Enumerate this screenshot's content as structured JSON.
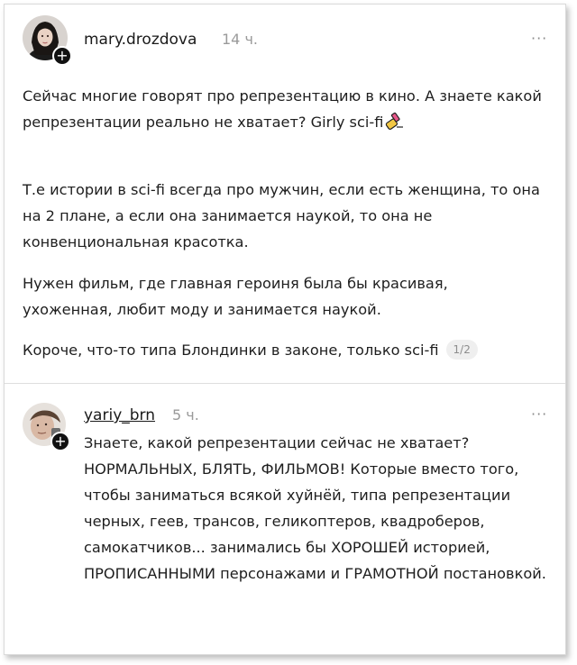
{
  "post1": {
    "username": "mary.drozdova",
    "time": "14 ч.",
    "more": "···",
    "para1": "Сейчас многие говорят про репрезентацию в кино. А знаете какой репрезентации реально не хватает? Girly sci-fi",
    "para1_icon": "nail-polish-icon",
    "para2": "Т.е истории в sci-fi всегда про мужчин, если есть женщина, то она на 2 плане, а если она занимается наукой, то она не конвенциональная красотка.",
    "para3": "Нужен фильм, где главная героиня была бы красивая, ухоженная, любит моду и занимается наукой.",
    "para4": "Короче, что-то типа Блондинки в законе, только sci-fi",
    "page_indicator": "1/2"
  },
  "post2": {
    "username": "yariy_brn",
    "time": "5 ч.",
    "more": "···",
    "text": "Знаете, какой репрезентации сейчас не хватает? НОРМАЛЬНЫХ, БЛЯТЬ, ФИЛЬМОВ! Которые вместо того, чтобы заниматься всякой хуйнёй, типа репрезентации черных, геев, трансов, геликоптеров, квадроберов, самокатчиков... занимались бы ХОРОШЕЙ историей, ПРОПИСАННЫМИ персонажами и ГРАМОТНОЙ постановкой."
  },
  "colors": {
    "text": "#1e1e1e",
    "muted": "#9a9a9a",
    "badge_bg": "#efefef",
    "divider": "#dedede"
  }
}
